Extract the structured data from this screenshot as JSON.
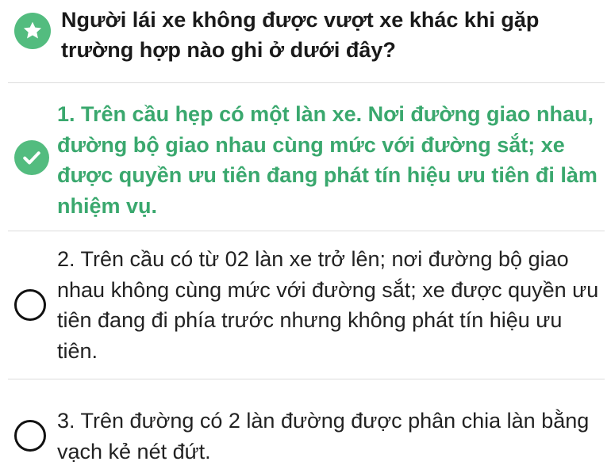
{
  "question": {
    "icon": "star-icon",
    "text": "Người lái xe không được vượt xe khác khi gặp trường hợp nào ghi ở dưới đây?"
  },
  "answers": [
    {
      "text": "1. Trên cầu hẹp có một làn xe. Nơi đường giao nhau, đường bộ giao nhau cùng mức với đường sắt; xe được quyền ưu tiên đang phát tín hiệu ưu tiên đi làm nhiệm vụ.",
      "selected": true,
      "icon": "check-icon"
    },
    {
      "text": "2. Trên cầu có từ 02 làn xe trở lên; nơi đường bộ giao nhau không cùng mức với đường sắt; xe được quyền ưu tiên đang đi phía trước nhưng không phát tín hiệu ưu tiên.",
      "selected": false,
      "icon": "radio-icon"
    },
    {
      "text": "3. Trên đường có 2 làn đường được phân chia làn bằng vạch kẻ nét đứt.",
      "selected": false,
      "icon": "radio-icon"
    }
  ],
  "colors": {
    "accent_green": "#53bc7f",
    "correct_text": "#3aa86e",
    "divider": "#dcdcdc"
  }
}
